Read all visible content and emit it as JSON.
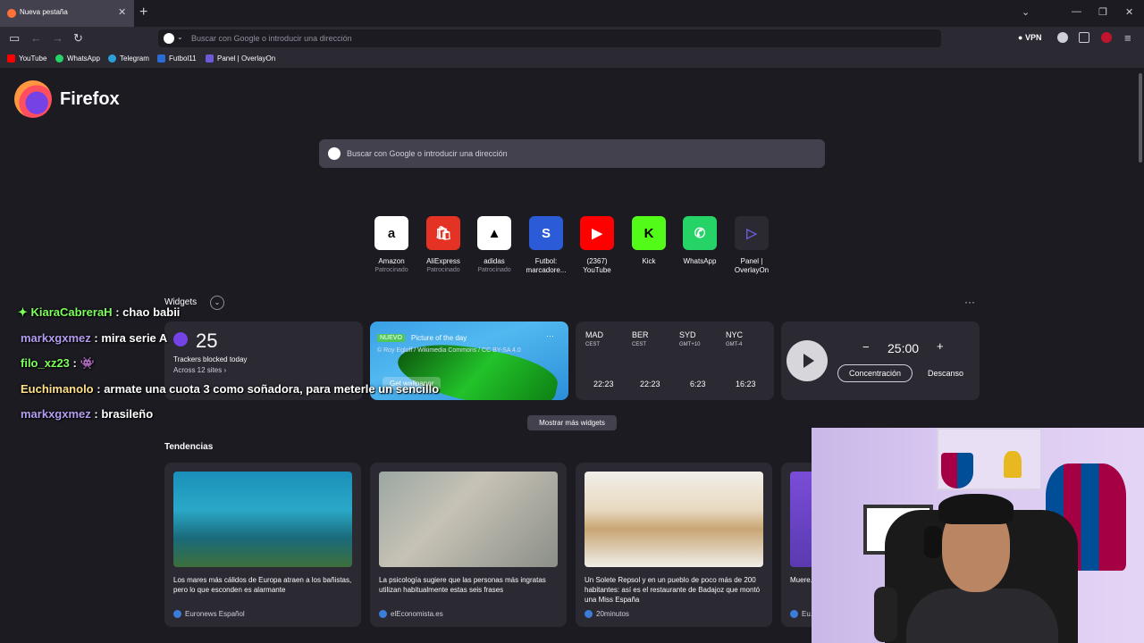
{
  "browser": {
    "tab_title": "Nueva pestaña",
    "url_placeholder": "Buscar con Google o introducir una dirección",
    "vpn_label": "VPN"
  },
  "bookmarks": [
    {
      "label": "YouTube",
      "color": "#ff0000"
    },
    {
      "label": "WhatsApp",
      "color": "#25d366"
    },
    {
      "label": "Telegram",
      "color": "#2aa1da"
    },
    {
      "label": "Futbol11",
      "color": "#2b6bd6"
    },
    {
      "label": "Panel | OverlayOn",
      "color": "#6b5bd6"
    }
  ],
  "newtab": {
    "logo_text": "Firefox",
    "search_placeholder": "Buscar con Google o introducir una dirección",
    "shortcuts": [
      {
        "label": "Amazon",
        "sub": "Patrocinado",
        "icon": "a",
        "bg": "#ffffff",
        "fg": "#111111"
      },
      {
        "label": "AliExpress",
        "sub": "Patrocinado",
        "icon": "🛍",
        "bg": "#e43225",
        "fg": "#ffffff"
      },
      {
        "label": "adidas",
        "sub": "Patrocinado",
        "icon": "▲",
        "bg": "#ffffff",
        "fg": "#000000"
      },
      {
        "label": "Futbol: marcadore...",
        "sub": "",
        "icon": "S",
        "bg": "#2b5bd7",
        "fg": "#ffffff"
      },
      {
        "label": "(2367) YouTube",
        "sub": "",
        "icon": "▶",
        "bg": "#ff0000",
        "fg": "#ffffff"
      },
      {
        "label": "Kick",
        "sub": "",
        "icon": "K",
        "bg": "#53fc18",
        "fg": "#000000"
      },
      {
        "label": "WhatsApp",
        "sub": "",
        "icon": "✆",
        "bg": "#25d366",
        "fg": "#ffffff"
      },
      {
        "label": "Panel | OverlayOn",
        "sub": "",
        "icon": "▷",
        "bg": "#2b2a33",
        "fg": "#6b5bd6"
      }
    ],
    "widgets_label": "Widgets",
    "tracker": {
      "count": "25",
      "line1": "Trackers blocked today",
      "line2": "Across 12 sites ›"
    },
    "potd": {
      "badge": "NUEVO",
      "title": "Picture of the day",
      "credit": "© Roy Egloff / Wikimedia Commons / CC BY-SA 4.0",
      "button": "Get wallpaper"
    },
    "clocks": [
      {
        "city": "MAD",
        "tz": "CEST",
        "time": "22:23"
      },
      {
        "city": "BER",
        "tz": "CEST",
        "time": "22:23"
      },
      {
        "city": "SYD",
        "tz": "GMT+10",
        "time": "6:23"
      },
      {
        "city": "NYC",
        "tz": "GMT-4",
        "time": "16:23"
      }
    ],
    "timer": {
      "value": "25:00",
      "minus": "−",
      "plus": "+",
      "focus": "Concentración",
      "rest": "Descanso"
    },
    "more_widgets": "Mostrar más widgets",
    "trends_title": "Tendencias",
    "stories": [
      {
        "title": "Los mares más cálidos de Europa atraen a los bañistas, pero lo que esconden es alarmante",
        "source": "Euronews Español",
        "img": "linear-gradient(180deg,#1a8fb8 0%,#2aa8c8 40%,#1a6a7a 70%,#3d6f3a 100%)"
      },
      {
        "title": "La psicología sugiere que las personas más ingratas utilizan habitualmente estas seis frases",
        "source": "elEconomista.es",
        "img": "linear-gradient(135deg,#9aa7a2 0%,#c7c2b6 40%,#8b8f88 100%)"
      },
      {
        "title": "Un Solete Repsol y en un pueblo de poco más de 200 habitantes: así es el restaurante de Badajoz que montó una Miss España",
        "source": "20minutos",
        "img": "linear-gradient(180deg,#f1efe9 0%,#e8d9c0 40%,#c9a574 60%,#efeee9 100%)"
      },
      {
        "title": "Muere... y pad...",
        "source": "Eu...",
        "img": "linear-gradient(180deg,#7a4dd8,#5a3ab0)"
      }
    ]
  },
  "chat": [
    {
      "user": "KiaraCabreraH",
      "color": "#7cff5a",
      "msg": ": chao babii"
    },
    {
      "user": "markxgxmez",
      "color": "#b49cf0",
      "msg": ": mira serie A"
    },
    {
      "user": "filo_xz23",
      "color": "#7cff5a",
      "msg": ": 👾"
    },
    {
      "user": "Euchimanolo",
      "color": "#ffe08a",
      "msg": ": armate una cuota 3 como soñadora, para meterle un sencillo"
    },
    {
      "user": "markxgxmez",
      "color": "#b49cf0",
      "msg": ": brasileño"
    }
  ]
}
